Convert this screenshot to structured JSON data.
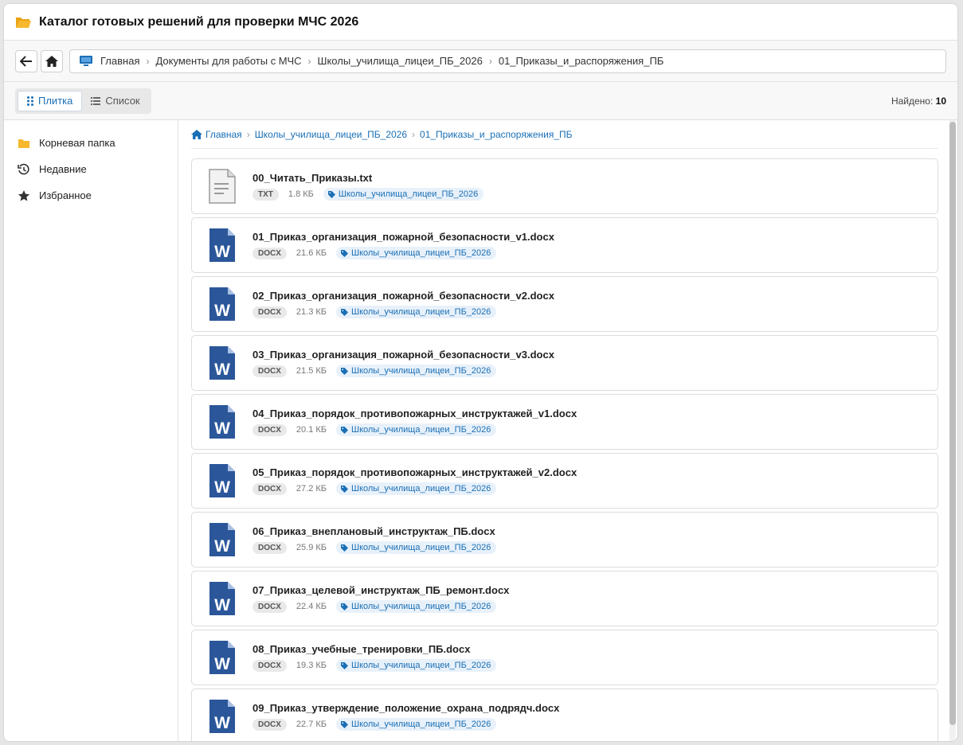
{
  "window": {
    "title": "Каталог готовых решений для проверки МЧС 2026"
  },
  "nav": {
    "address": [
      "Главная",
      "Документы для работы с МЧС",
      "Школы_училища_лицеи_ПБ_2026",
      "01_Приказы_и_распоряжения_ПБ"
    ],
    "sep": "›"
  },
  "toolbar": {
    "tile_label": "Плитка",
    "list_label": "Список",
    "found_label": "Найдено:",
    "found_count": "10"
  },
  "sidebar": {
    "items": [
      {
        "label": "Корневая папка",
        "icon": "folder-icon"
      },
      {
        "label": "Недавние",
        "icon": "history-icon"
      },
      {
        "label": "Избранное",
        "icon": "star-icon"
      }
    ]
  },
  "crumbs": [
    "Главная",
    "Школы_училища_лицеи_ПБ_2026",
    "01_Приказы_и_распоряжения_ПБ"
  ],
  "files": [
    {
      "name": "00_Читать_Приказы.txt",
      "ext": "TXT",
      "size": "1.8 КБ",
      "tag": "Школы_училища_лицеи_ПБ_2026"
    },
    {
      "name": "01_Приказ_организация_пожарной_безопасности_v1.docx",
      "ext": "DOCX",
      "size": "21.6 КБ",
      "tag": "Школы_училища_лицеи_ПБ_2026"
    },
    {
      "name": "02_Приказ_организация_пожарной_безопасности_v2.docx",
      "ext": "DOCX",
      "size": "21.3 КБ",
      "tag": "Школы_училища_лицеи_ПБ_2026"
    },
    {
      "name": "03_Приказ_организация_пожарной_безопасности_v3.docx",
      "ext": "DOCX",
      "size": "21.5 КБ",
      "tag": "Школы_училища_лицеи_ПБ_2026"
    },
    {
      "name": "04_Приказ_порядок_противопожарных_инструктажей_v1.docx",
      "ext": "DOCX",
      "size": "20.1 КБ",
      "tag": "Школы_училища_лицеи_ПБ_2026"
    },
    {
      "name": "05_Приказ_порядок_противопожарных_инструктажей_v2.docx",
      "ext": "DOCX",
      "size": "27.2 КБ",
      "tag": "Школы_училища_лицеи_ПБ_2026"
    },
    {
      "name": "06_Приказ_внеплановый_инструктаж_ПБ.docx",
      "ext": "DOCX",
      "size": "25.9 КБ",
      "tag": "Школы_училища_лицеи_ПБ_2026"
    },
    {
      "name": "07_Приказ_целевой_инструктаж_ПБ_ремонт.docx",
      "ext": "DOCX",
      "size": "22.4 КБ",
      "tag": "Школы_училища_лицеи_ПБ_2026"
    },
    {
      "name": "08_Приказ_учебные_тренировки_ПБ.docx",
      "ext": "DOCX",
      "size": "19.3 КБ",
      "tag": "Школы_училища_лицеи_ПБ_2026"
    },
    {
      "name": "09_Приказ_утверждение_положение_охрана_подрядч.docx",
      "ext": "DOCX",
      "size": "22.7 КБ",
      "tag": "Школы_училища_лицеи_ПБ_2026"
    }
  ],
  "colors": {
    "accent": "#1a6fb5",
    "word": "#2b579a",
    "folder": "#f5b82e"
  }
}
